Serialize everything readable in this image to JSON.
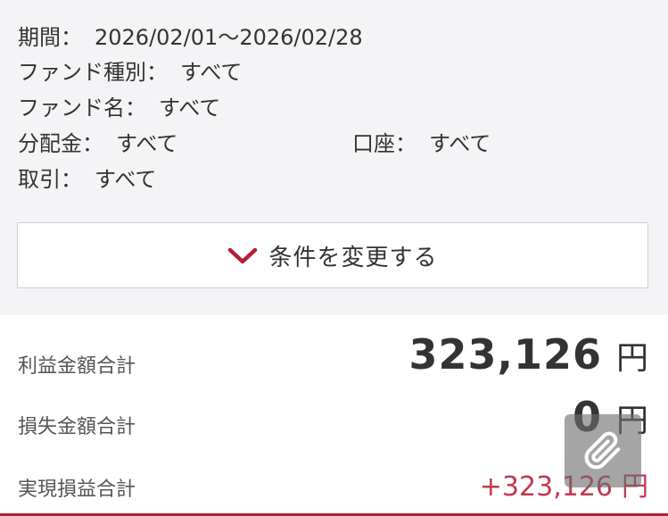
{
  "conditions": {
    "period": {
      "label": "期間：",
      "value": "2026/02/01〜2026/02/28"
    },
    "fund_type": {
      "label": "ファンド種別：",
      "value": "すべて"
    },
    "fund_name": {
      "label": "ファンド名：",
      "value": "すべて"
    },
    "distribution": {
      "label": "分配金：",
      "value": "すべて"
    },
    "account": {
      "label": "口座：",
      "value": "すべて"
    },
    "transaction": {
      "label": "取引：",
      "value": "すべて"
    }
  },
  "change_button": {
    "label": "条件を変更する",
    "icon": "chevron-down-icon"
  },
  "summary": {
    "profit_total": {
      "label": "利益金額合計",
      "value": "323,126",
      "unit": "円"
    },
    "loss_total": {
      "label": "損失金額合計",
      "value": "0",
      "unit": "円"
    },
    "realized_total": {
      "label": "実現損益合計",
      "value": "+323,126",
      "unit": "円"
    }
  },
  "floating": {
    "icon": "paperclip-icon"
  },
  "colors": {
    "accent": "#b3203a",
    "positive": "#c0394f",
    "panel_bg": "#f4f4f6"
  }
}
